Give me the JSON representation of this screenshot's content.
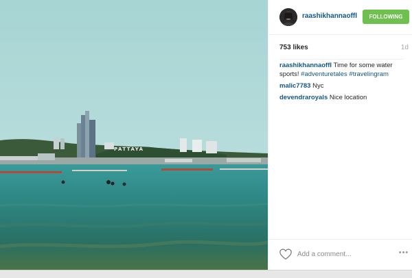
{
  "post": {
    "photo_sign": "PATTAYA",
    "author": {
      "username": "raashikhannaoffl",
      "avatar_icon": "profile-photo"
    },
    "follow_button_label": "FOLLOWING",
    "follow_button_color": "#70c050",
    "likes": "753 likes",
    "timestamp": "1d",
    "caption": {
      "username": "raashikhannaoffl",
      "text": "Time for some water sports!",
      "hashtag_1": "#adventuretales",
      "hashtag_2": "#travelingram"
    },
    "comments": [
      {
        "username": "malic7783",
        "text": "Nyc"
      },
      {
        "username": "devendraroyals",
        "text": "Nice location"
      }
    ],
    "comment_input_placeholder": "Add a comment...",
    "like_icon": "heart-outline",
    "more_icon": "ellipsis",
    "link_color": "#125688"
  }
}
